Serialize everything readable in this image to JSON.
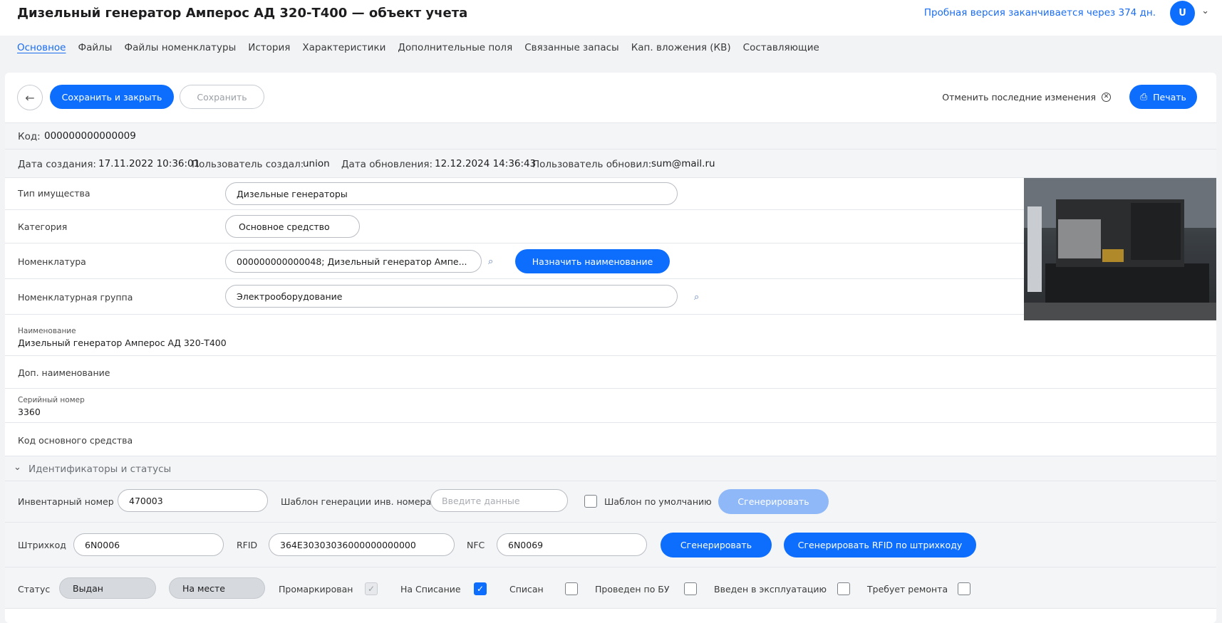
{
  "header": {
    "title": "Дизельный генератор Амперос АД 320-Т400 — объект учета",
    "trial_notice": "Пробная версия заканчивается через 374 дн.",
    "avatar_initial": "U"
  },
  "tabs": [
    {
      "label": "Основное",
      "active": true
    },
    {
      "label": "Файлы"
    },
    {
      "label": "Файлы номенклатуры"
    },
    {
      "label": "История"
    },
    {
      "label": "Характеристики"
    },
    {
      "label": "Дополнительные поля"
    },
    {
      "label": "Связанные запасы"
    },
    {
      "label": "Кап. вложения (КВ)"
    },
    {
      "label": "Составляющие"
    }
  ],
  "toolbar": {
    "save_close_label": "Сохранить и закрыть",
    "save_label": "Сохранить",
    "undo_label": "Отменить последние изменения",
    "print_label": "Печать"
  },
  "meta": {
    "code_label": "Код:",
    "code_value": "000000000000009",
    "created_label": "Дата создания:",
    "created_value": "17.11.2022 10:36:01",
    "created_by_label": "Пользователь создал:",
    "created_by_value": "union",
    "updated_label": "Дата обновления:",
    "updated_value": "12.12.2024 14:36:43",
    "updated_by_label": "Пользователь обновил:",
    "updated_by_value": "sum@mail.ru"
  },
  "fields": {
    "property_type_label": "Тип имущества",
    "property_type_value": "Дизельные генераторы",
    "category_label": "Категория",
    "category_value": "Основное средство",
    "nomenclature_label": "Номенклатура",
    "nomenclature_value": "000000000000048; Дизельный генератор Ампе...",
    "assign_name_label": "Назначить наименование",
    "nomenclature_group_label": "Номенклатурная группа",
    "nomenclature_group_value": "Электрооборудование",
    "name_label": "Наименование",
    "name_value": "Дизельный генератор Амперос АД 320-Т400",
    "extra_name_label": "Доп. наименование",
    "serial_label": "Серийный номер",
    "serial_value": "3360",
    "asset_code_label": "Код основного средства"
  },
  "identifiers": {
    "section_label": "Идентификаторы и статусы",
    "inventory_label": "Инвентарный номер",
    "inventory_value": "470003",
    "template_label": "Шаблон генерации инв. номера",
    "template_placeholder": "Введите данные",
    "default_template_label": "Шаблон по умолчанию",
    "generate_label": "Сгенерировать",
    "barcode_label": "Штрихкод",
    "barcode_value": "6N0006",
    "rfid_label": "RFID",
    "rfid_value": "364E30303036000000000000",
    "nfc_label": "NFC",
    "nfc_value": "6N0069",
    "generate2_label": "Сгенерировать",
    "generate_rfid_label": "Сгенерировать RFID по штрихкоду"
  },
  "statuses": {
    "status_label": "Статус",
    "status_issued": "Выдан",
    "status_in_place": "На месте",
    "marked_label": "Промаркирован",
    "for_writeoff_label": "На Списание",
    "written_off_label": "Списан",
    "accounted_label": "Проведен по БУ",
    "commissioned_label": "Введен в эксплуатацию",
    "needs_repair_label": "Требует ремонта"
  }
}
